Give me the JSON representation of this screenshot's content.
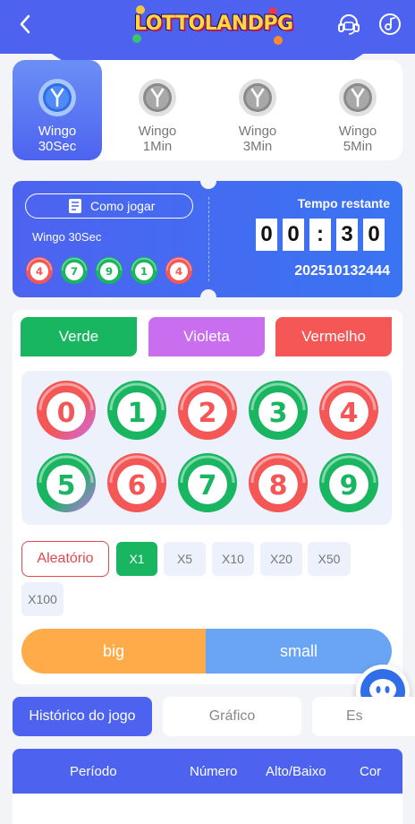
{
  "header": {
    "logo_text": "LOTTOLANDPG",
    "icons": [
      "back-arrow-icon",
      "headset-icon",
      "music-note-icon"
    ]
  },
  "game_tabs": [
    {
      "line1": "Wingo",
      "line2": "30Sec",
      "active": true
    },
    {
      "line1": "Wingo",
      "line2": "1Min",
      "active": false
    },
    {
      "line1": "Wingo",
      "line2": "3Min",
      "active": false
    },
    {
      "line1": "Wingo",
      "line2": "5Min",
      "active": false
    }
  ],
  "ticket": {
    "how_to_play": "Como jogar",
    "game_name": "Wingo 30Sec",
    "recent_results": [
      4,
      7,
      9,
      1,
      4
    ],
    "time_label": "Tempo restante",
    "timer_digits": [
      "0",
      "0",
      ":",
      "3",
      "0"
    ],
    "period_id": "202510132444"
  },
  "colors": {
    "primary": "#4d63f0",
    "green": "#18b660",
    "violet": "#c86eee",
    "red": "#f55656",
    "big": "#ffab4a",
    "small": "#6aa5f5"
  },
  "color_buttons": {
    "green": "Verde",
    "violet": "Violeta",
    "red": "Vermelho"
  },
  "numbers": [
    0,
    1,
    2,
    3,
    4,
    5,
    6,
    7,
    8,
    9
  ],
  "random_label": "Aleatório",
  "multipliers": [
    "X1",
    "X5",
    "X10",
    "X20",
    "X50",
    "X100"
  ],
  "big_label": "big",
  "small_label": "small",
  "history_tabs": [
    "Histórico do jogo",
    "Gráfico",
    "Es"
  ],
  "table_headers": [
    "Período",
    "Número",
    "Alto/Baixo",
    "Cor"
  ]
}
